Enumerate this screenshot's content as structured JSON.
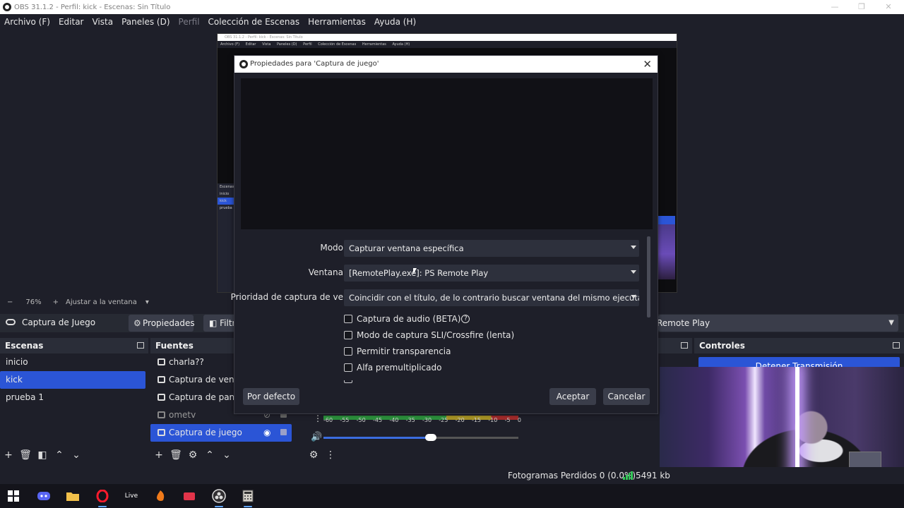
{
  "window": {
    "title": "OBS 31.1.2 - Perfil: kick - Escenas: Sin Título",
    "minimize": "—",
    "maximize": "❐",
    "close": "✕"
  },
  "menu": [
    {
      "label": "Archivo (F)"
    },
    {
      "label": "Editar"
    },
    {
      "label": "Vista"
    },
    {
      "label": "Paneles (D)"
    },
    {
      "label": "Perfil"
    },
    {
      "label": "Colección de Escenas"
    },
    {
      "label": "Herramientas"
    },
    {
      "label": "Ayuda (H)"
    }
  ],
  "zoom": {
    "minus": "−",
    "value": "76%",
    "plus": "+",
    "fit": "Ajustar a la ventana"
  },
  "context_bar": {
    "source_name": "Captura de Juego",
    "properties_label": "Propiedades",
    "filters_label": "Filtros",
    "window_value": "Remote Play"
  },
  "scenes": {
    "title": "Escenas",
    "items": [
      {
        "label": "inicio",
        "selected": false
      },
      {
        "label": "kick",
        "selected": true
      },
      {
        "label": "prueba 1",
        "selected": false
      }
    ]
  },
  "sources": {
    "title": "Fuentes",
    "items": [
      {
        "label": "charla??",
        "icon": "camera-icon"
      },
      {
        "label": "Captura de ventana",
        "icon": "window-icon"
      },
      {
        "label": "Captura de pantalla",
        "icon": "monitor-icon"
      },
      {
        "label": "ometv",
        "icon": "browser-icon",
        "hidden": true
      },
      {
        "label": "Captura de juego",
        "icon": "gamepad-icon",
        "selected": true
      }
    ]
  },
  "mixer": {
    "ticks": [
      "-60",
      "-55",
      "-50",
      "-45",
      "-40",
      "-35",
      "-30",
      "-25",
      "-20",
      "-15",
      "-10",
      "-5",
      "0"
    ],
    "volume_level": 0.55
  },
  "controls": {
    "title": "Controles",
    "stop_stream_label": "Detener Transmisión"
  },
  "status": {
    "dropped_frames": "Fotogramas Perdidos 0 (0.0%)",
    "bitrate": "5491 kb"
  },
  "dialog": {
    "title": "Propiedades para 'Captura de juego'",
    "close": "✕",
    "mode_label": "Modo",
    "mode_value": "Capturar ventana específica",
    "window_label": "Ventana",
    "window_value": "[RemotePlay.exe]: PS Remote Play",
    "priority_label": "Prioridad de captura de ve",
    "priority_value": "Coincidir con el título, de lo contrario buscar ventana del mismo ejecutable",
    "checkboxes": [
      {
        "label": "Captura de audio (BETA)",
        "checked": false,
        "help": "?"
      },
      {
        "label": "Modo de captura SLI/Crossfire (lenta)",
        "checked": false
      },
      {
        "label": "Permitir transparencia",
        "checked": false
      },
      {
        "label": "Alfa premultiplicado",
        "checked": false
      }
    ],
    "defaults_button": "Por defecto",
    "accept_button": "Aceptar",
    "cancel_button": "Cancelar"
  },
  "nested_preview": {
    "menu": [
      "Archivo (F)",
      "Editar",
      "Vista",
      "Paneles (D)",
      "Perfil",
      "Colección de Escenas",
      "Herramientas",
      "Ayuda (H)"
    ],
    "scenes": [
      "Escenas",
      "inicio",
      "kick",
      "prueba"
    ]
  },
  "taskbar": [
    "windows-start-icon",
    "discord-icon",
    "file-explorer-icon",
    "opera-icon",
    "live-icon",
    "fl-studio-icon",
    "app-icon",
    "obs-icon",
    "calculator-icon"
  ],
  "colors": {
    "accent": "#2b55d6",
    "background": "#1e1f29",
    "panel": "#2a2d38"
  }
}
